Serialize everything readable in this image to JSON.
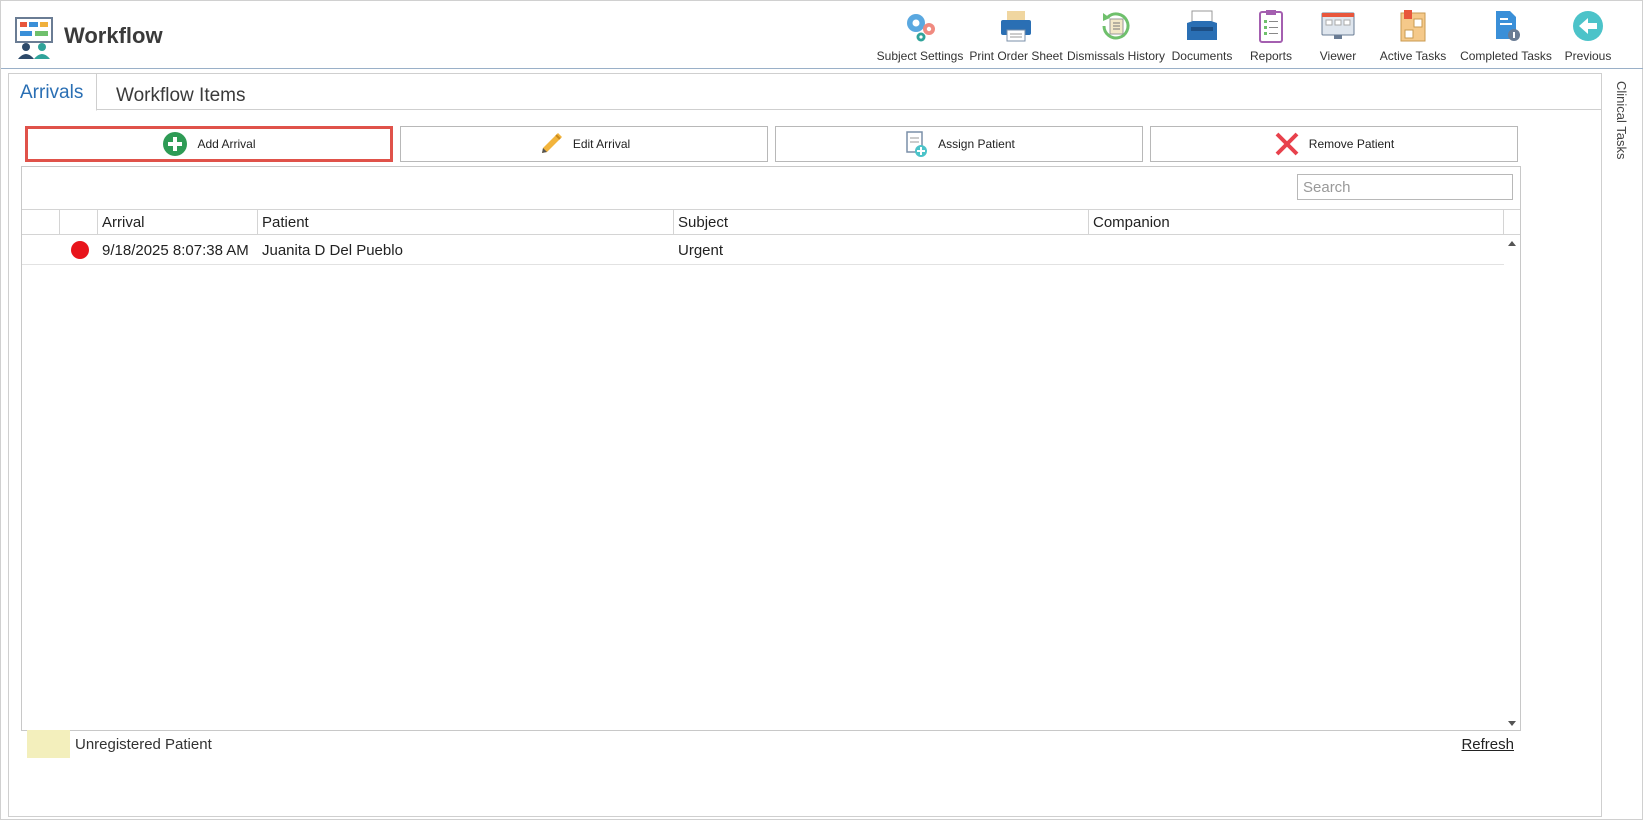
{
  "app": {
    "title": "Workflow"
  },
  "toolbar": {
    "items": [
      {
        "label": "Subject Settings",
        "icon": "gears-icon"
      },
      {
        "label": "Print Order Sheet",
        "icon": "printer-icon"
      },
      {
        "label": "Dismissals History",
        "icon": "history-icon"
      },
      {
        "label": "Documents",
        "icon": "inbox-icon"
      },
      {
        "label": "Reports",
        "icon": "clipboard-icon"
      },
      {
        "label": "Viewer",
        "icon": "monitor-icon"
      },
      {
        "label": "Active Tasks",
        "icon": "task-board-icon"
      },
      {
        "label": "Completed Tasks",
        "icon": "completed-document-icon"
      },
      {
        "label": "Previous",
        "icon": "back-arrow-icon"
      }
    ]
  },
  "tabs": [
    {
      "label": "Arrivals",
      "active": true
    },
    {
      "label": "Workflow Items",
      "active": false
    }
  ],
  "actions": {
    "add": "Add Arrival",
    "edit": "Edit Arrival",
    "assign": "Assign Patient",
    "remove": "Remove Patient"
  },
  "search": {
    "placeholder": "Search",
    "value": ""
  },
  "grid": {
    "columns": [
      "Arrival",
      "Patient",
      "Subject",
      "Companion"
    ],
    "rows": [
      {
        "status_color": "#e8141c",
        "arrival": "9/18/2025 8:07:38 AM",
        "patient": "Juanita D Del Pueblo",
        "subject": "Urgent",
        "companion": ""
      }
    ]
  },
  "legend": {
    "label": "Unregistered Patient",
    "color": "#f3efbc"
  },
  "refresh": {
    "label": "Refresh"
  },
  "side_panel": {
    "label": "Clinical Tasks"
  },
  "colors": {
    "accent": "#2a6fb4",
    "highlight": "#e0524a"
  }
}
